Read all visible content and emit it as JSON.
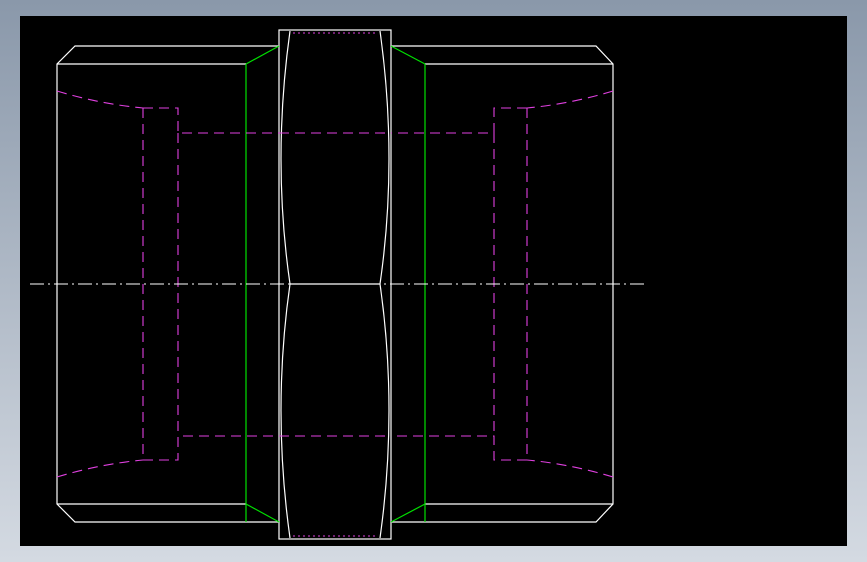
{
  "view": {
    "background_gradient_top": "#8a98aa",
    "background_gradient_bottom": "#d4dae2",
    "viewport_background": "#000000"
  },
  "colors": {
    "visible_edges": "#ffffff",
    "tangent_edges": "#00e000",
    "hidden_edges": "#e040e0",
    "centerline": "#ffffff"
  },
  "icons": {
    "centerline": "dash-dot-centerline-icon"
  }
}
